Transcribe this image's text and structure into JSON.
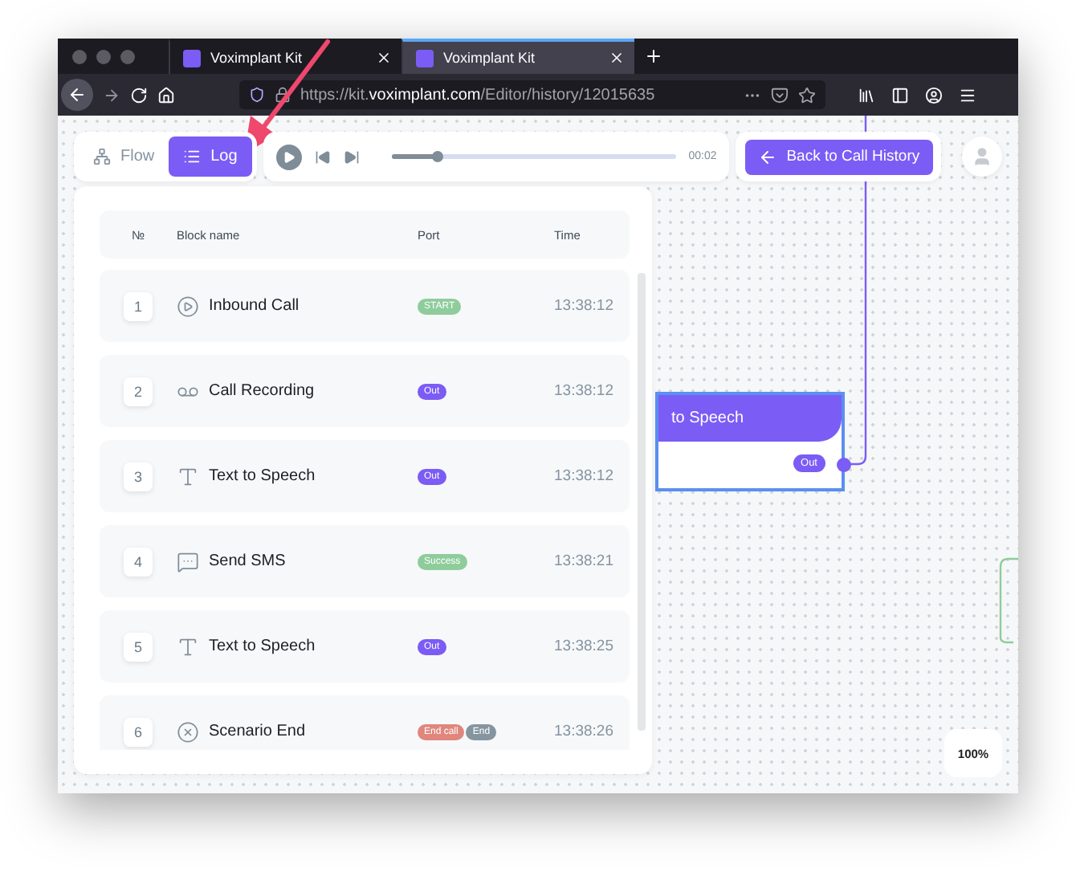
{
  "browser": {
    "tabs": [
      {
        "title": "Voximplant Kit",
        "selected": false
      },
      {
        "title": "Voximplant Kit",
        "selected": true
      }
    ],
    "url": "https://kit.**voximplant.com**/Editor/history/12015635"
  },
  "toolbar": {
    "views": [
      {
        "label": "Flow",
        "kind": "flow",
        "selected": false
      },
      {
        "label": "Log",
        "kind": "log",
        "selected": true
      }
    ],
    "player": {
      "level": 0.16,
      "time": "00:02"
    },
    "back_button": "Back to Call History"
  },
  "log": {
    "columns": [
      "№",
      "Block name",
      "Port",
      "Time"
    ],
    "rows": [
      {
        "number": "1",
        "kind": "inbound_call",
        "name": "Inbound Call",
        "ports": [
          {
            "label": "START",
            "color": "#8fcc9b"
          }
        ],
        "time": "13:38:12"
      },
      {
        "number": "2",
        "kind": "call_recording",
        "name": "Call Recording",
        "ports": [
          {
            "label": "Out",
            "color": "#7b5cf5"
          }
        ],
        "time": "13:38:12"
      },
      {
        "number": "3",
        "kind": "text_to_speech",
        "name": "Text to Speech",
        "ports": [
          {
            "label": "Out",
            "color": "#7b5cf5"
          }
        ],
        "time": "13:38:12"
      },
      {
        "number": "4",
        "kind": "send_sms",
        "name": "Send SMS",
        "ports": [
          {
            "label": "Success",
            "color": "#8fcc9b"
          }
        ],
        "time": "13:38:21"
      },
      {
        "number": "5",
        "kind": "text_to_speech",
        "name": "Text to Speech",
        "ports": [
          {
            "label": "Out",
            "color": "#7b5cf5"
          }
        ],
        "time": "13:38:25"
      },
      {
        "number": "6",
        "kind": "scenario_end",
        "name": "Scenario End",
        "ports": [
          {
            "label": "End call",
            "color": "#e0867c"
          },
          {
            "label": "End",
            "color": "#85959f"
          }
        ],
        "time": "13:38:26"
      }
    ]
  },
  "canvas": {
    "node": {
      "title": "to Speech",
      "port": "Out"
    },
    "zoom": "100%"
  }
}
